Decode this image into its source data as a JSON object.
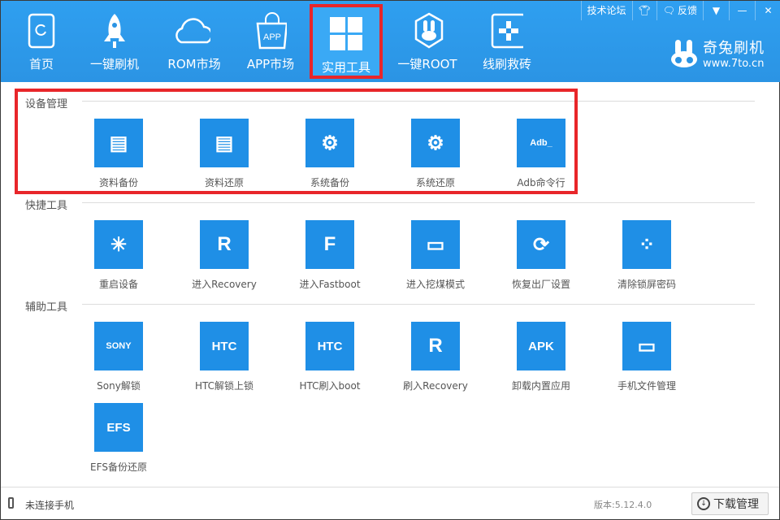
{
  "nav": [
    {
      "label": "首页",
      "icon": "phone-refresh-icon"
    },
    {
      "label": "一键刷机",
      "icon": "rocket-icon"
    },
    {
      "label": "ROM市场",
      "icon": "cloud-icon"
    },
    {
      "label": "APP市场",
      "icon": "app-bag-icon"
    },
    {
      "label": "实用工具",
      "icon": "grid-icon",
      "selected": true
    },
    {
      "label": "一键ROOT",
      "icon": "rabbit-icon"
    },
    {
      "label": "线刷救砖",
      "icon": "plus-box-icon"
    }
  ],
  "topbar": {
    "forum": "技术论坛",
    "feedback": "反馈"
  },
  "brand": {
    "name": "奇兔刷机",
    "url": "www.7to.cn"
  },
  "sections": [
    {
      "title": "设备管理",
      "tools": [
        {
          "label": "资料备份",
          "glyph": "▤"
        },
        {
          "label": "资料还原",
          "glyph": "▤"
        },
        {
          "label": "系统备份",
          "glyph": "⚙"
        },
        {
          "label": "系统还原",
          "glyph": "⚙"
        },
        {
          "label": "Adb命令行",
          "glyph": "Adb_"
        }
      ]
    },
    {
      "title": "快捷工具",
      "tools": [
        {
          "label": "重启设备",
          "glyph": "✳"
        },
        {
          "label": "进入Recovery",
          "glyph": "R"
        },
        {
          "label": "进入Fastboot",
          "glyph": "F"
        },
        {
          "label": "进入挖煤模式",
          "glyph": "▭"
        },
        {
          "label": "恢复出厂设置",
          "glyph": "⟳"
        },
        {
          "label": "清除锁屏密码",
          "glyph": "⁘"
        }
      ]
    },
    {
      "title": "辅助工具",
      "tools": [
        {
          "label": "Sony解锁",
          "glyph": "SONY"
        },
        {
          "label": "HTC解锁上锁",
          "glyph": "HTC"
        },
        {
          "label": "HTC刷入boot",
          "glyph": "HTC"
        },
        {
          "label": "刷入Recovery",
          "glyph": "R"
        },
        {
          "label": "卸载内置应用",
          "glyph": "APK"
        },
        {
          "label": "手机文件管理",
          "glyph": "▭"
        },
        {
          "label": "EFS备份还原",
          "glyph": "EFS"
        }
      ]
    }
  ],
  "status": {
    "connection": "未连接手机",
    "version": "版本:5.12.4.0",
    "download": "下载管理"
  }
}
